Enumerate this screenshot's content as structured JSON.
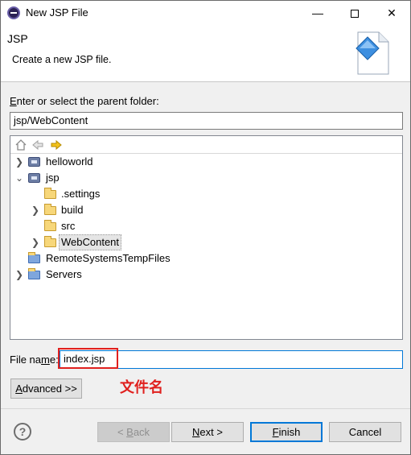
{
  "window": {
    "title": "New JSP File",
    "minimize_glyph": "—",
    "close_glyph": "✕"
  },
  "header": {
    "title": "JSP",
    "description": "Create a new JSP file."
  },
  "folder": {
    "label_prefix": "",
    "label_mnemonic": "E",
    "label_rest": "nter or select the parent folder:",
    "value": "jsp/WebContent"
  },
  "tree": {
    "toolbar": [
      "home-icon",
      "back-arrow-icon",
      "forward-arrow-icon"
    ],
    "items": [
      {
        "label": "helloworld",
        "type": "project",
        "expanded": false
      },
      {
        "label": "jsp",
        "type": "project",
        "expanded": true
      },
      {
        "label": ".settings",
        "type": "folder",
        "expanded": null
      },
      {
        "label": "build",
        "type": "folder",
        "expanded": false
      },
      {
        "label": "src",
        "type": "folder",
        "expanded": null
      },
      {
        "label": "WebContent",
        "type": "folder",
        "expanded": false,
        "selected": true
      },
      {
        "label": "RemoteSystemsTempFiles",
        "type": "project-folder",
        "expanded": null
      },
      {
        "label": "Servers",
        "type": "project-folder",
        "expanded": false
      }
    ]
  },
  "file_name": {
    "label_before": "File na",
    "label_mnemonic": "m",
    "label_after": "e:",
    "value": "index.jsp"
  },
  "advanced": {
    "mnemonic": "A",
    "rest": "dvanced >>"
  },
  "annotation": "文件名",
  "buttons": {
    "back": {
      "prefix": "< ",
      "mnemonic": "B",
      "rest": "ack"
    },
    "next": {
      "mnemonic": "N",
      "rest": "ext >"
    },
    "finish": {
      "mnemonic": "F",
      "rest": "inish"
    },
    "cancel": "Cancel"
  },
  "help_glyph": "?",
  "colors": {
    "accent": "#0078d7",
    "annotation_red": "#e0201e"
  }
}
